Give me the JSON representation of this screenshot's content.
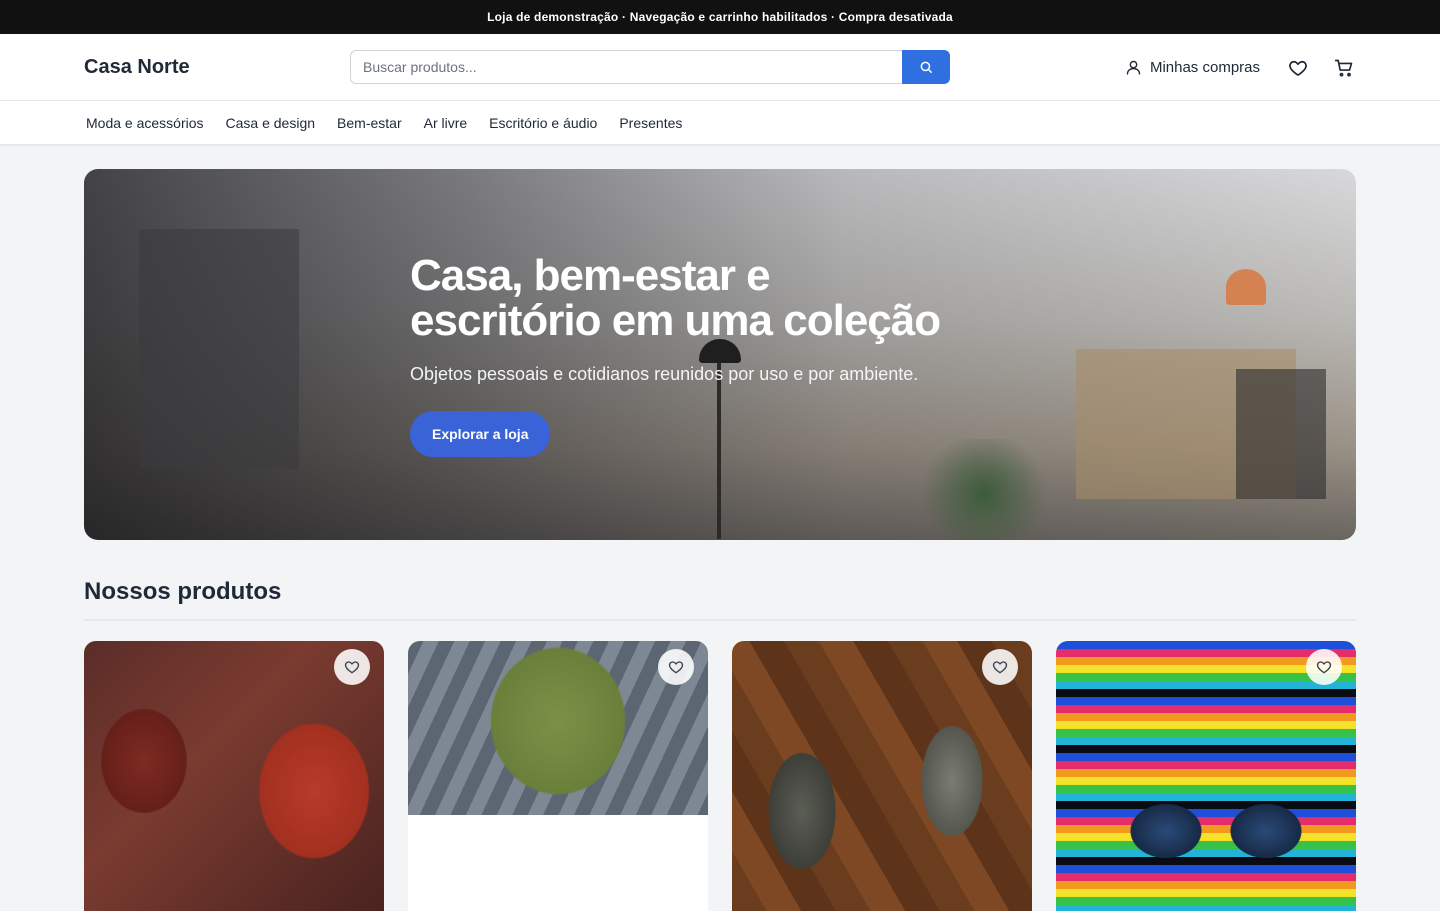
{
  "announcement": "Loja de demonstração · Navegação e carrinho habilitados · Compra desativada",
  "header": {
    "logo": "Casa Norte",
    "search_placeholder": "Buscar produtos...",
    "account_label": "Minhas compras"
  },
  "nav": {
    "items": [
      "Moda e acessórios",
      "Casa e design",
      "Bem-estar",
      "Ar livre",
      "Escritório e áudio",
      "Presentes"
    ]
  },
  "hero": {
    "title_line1": "Casa, bem-estar e",
    "title_line2": "escritório em uma coleção",
    "subtitle": "Objetos pessoais e cotidianos reunidos por uso e por ambiente.",
    "cta": "Explorar a loja"
  },
  "products": {
    "title": "Nossos produtos",
    "items": [
      {
        "image": "red-headphones"
      },
      {
        "image": "green-backpack"
      },
      {
        "image": "hiking-shoes"
      },
      {
        "image": "sunglasses-rainbow"
      }
    ]
  },
  "colors": {
    "accent": "#2f6fdf",
    "cta": "#3a63d8",
    "topbar": "#111111"
  }
}
